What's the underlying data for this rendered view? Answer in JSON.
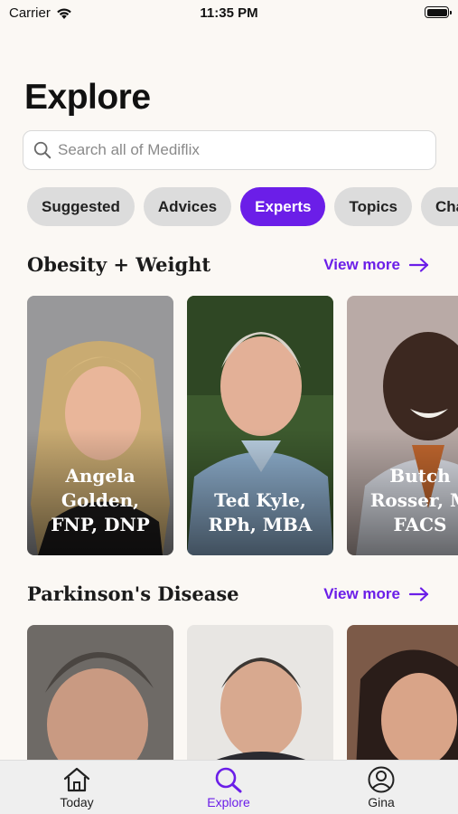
{
  "status_bar": {
    "carrier": "Carrier",
    "time": "11:35 PM"
  },
  "page": {
    "title": "Explore"
  },
  "search": {
    "placeholder": "Search all of Mediflix"
  },
  "chips": [
    {
      "label": "Suggested",
      "selected": false
    },
    {
      "label": "Advices",
      "selected": false
    },
    {
      "label": "Experts",
      "selected": true
    },
    {
      "label": "Topics",
      "selected": false
    },
    {
      "label": "Cha",
      "selected": false
    }
  ],
  "sections": [
    {
      "title": "Obesity + Weight",
      "view_more": "View more",
      "experts": [
        {
          "name": "Angela\nGolden,\nFNP, DNP"
        },
        {
          "name": "Ted Kyle,\nRPh, MBA"
        },
        {
          "name": "Butch\nRosser, M\nFACS"
        }
      ]
    },
    {
      "title": "Parkinson's Disease",
      "view_more": "View more",
      "experts": [
        {},
        {},
        {}
      ]
    }
  ],
  "tab_bar": {
    "tabs": [
      {
        "label": "Today",
        "icon": "house-icon"
      },
      {
        "label": "Explore",
        "icon": "search-icon",
        "active": true
      },
      {
        "label": "Gina",
        "icon": "user-circle-icon"
      }
    ]
  },
  "colors": {
    "accent": "#6b1ee8",
    "background": "#fbf8f4",
    "chip_bg": "#dcdcdc"
  }
}
